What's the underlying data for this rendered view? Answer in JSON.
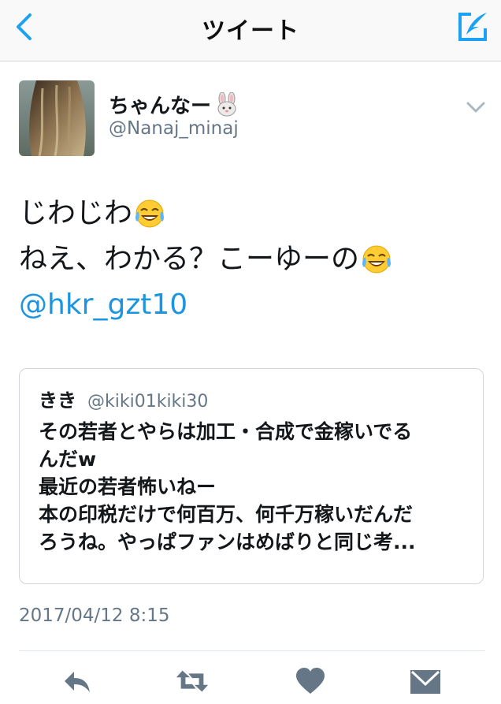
{
  "navbar": {
    "title": "ツイート",
    "back_icon": "chevron-left-icon",
    "compose_icon": "compose-quill-icon",
    "accent_color": "#1da1f2"
  },
  "author": {
    "display_name": "ちゃんなー",
    "handle": "@Nanaj_minaj",
    "name_emoji": "rabbit-face-icon",
    "menu_icon": "chevron-down-icon"
  },
  "tweet": {
    "lines": [
      "じわじわ",
      "ねえ、わかる？こーゆーの"
    ],
    "emoji": "tears-of-joy-icon",
    "mention": "@hkr_gzt10",
    "mention_color": "#1b95e0"
  },
  "quote": {
    "name": "きき",
    "handle": "@kiki01kiki30",
    "lines": [
      "その若者とやらは加工・合成で金稼いでる",
      "んだw",
      "最近の若者怖いねー",
      "本の印税だけで何百万、何千万稼いだんだ",
      "ろうね。やっぱファンはめばりと同じ考..."
    ]
  },
  "timestamp": "2017/04/12 8:15",
  "actions": {
    "reply_icon": "reply-icon",
    "retweet_icon": "retweet-icon",
    "like_icon": "heart-icon",
    "dm_icon": "envelope-icon",
    "icon_color": "#657786"
  }
}
